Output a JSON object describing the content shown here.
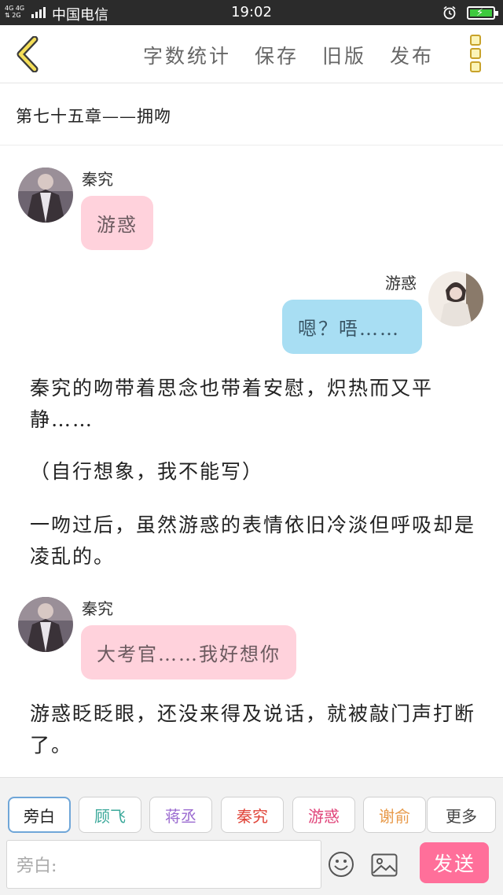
{
  "status_bar": {
    "signal": "4G 4G\n2G",
    "carrier": "中国电信",
    "time": "19:02"
  },
  "toolbar": {
    "actions": [
      "字数统计",
      "保存",
      "旧版",
      "发布"
    ]
  },
  "chapter": {
    "title": "第七十五章——拥吻"
  },
  "messages": [
    {
      "type": "dialog",
      "side": "left",
      "speaker": "秦究",
      "text": "游惑",
      "bubble_color": "#ffd2dc"
    },
    {
      "type": "dialog",
      "side": "right",
      "speaker": "游惑",
      "text": "嗯？唔……",
      "bubble_color": "#a8def3"
    },
    {
      "type": "narration",
      "text": "秦究的吻带着思念也带着安慰，炽热而又平静……"
    },
    {
      "type": "narration",
      "text": "（自行想象，我不能写）"
    },
    {
      "type": "narration",
      "text": "一吻过后，虽然游惑的表情依旧冷淡但呼吸却是凌乱的。"
    },
    {
      "type": "dialog",
      "side": "left",
      "speaker": "秦究",
      "text": "大考官……我好想你",
      "bubble_color": "#ffd2dc"
    },
    {
      "type": "narration",
      "text": "游惑眨眨眼，还没来得及说话，就被敲门声打断了。"
    }
  ],
  "roles": [
    {
      "label": "旁白",
      "color": "#666666",
      "selected": true
    },
    {
      "label": "顾飞",
      "color": "#3aa89a",
      "selected": false
    },
    {
      "label": "蒋丞",
      "color": "#9b6bd0",
      "selected": false
    },
    {
      "label": "秦究",
      "color": "#e0453a",
      "selected": false
    },
    {
      "label": "游惑",
      "color": "#e0457a",
      "selected": false
    },
    {
      "label": "谢俞",
      "color": "#e89a4a",
      "selected": false
    },
    {
      "label": "更多",
      "color": "#444444",
      "selected": false
    }
  ],
  "composer": {
    "placeholder": "旁白:",
    "send_label": "发送",
    "emoji_icon": "smiley-icon",
    "image_icon": "image-icon"
  }
}
